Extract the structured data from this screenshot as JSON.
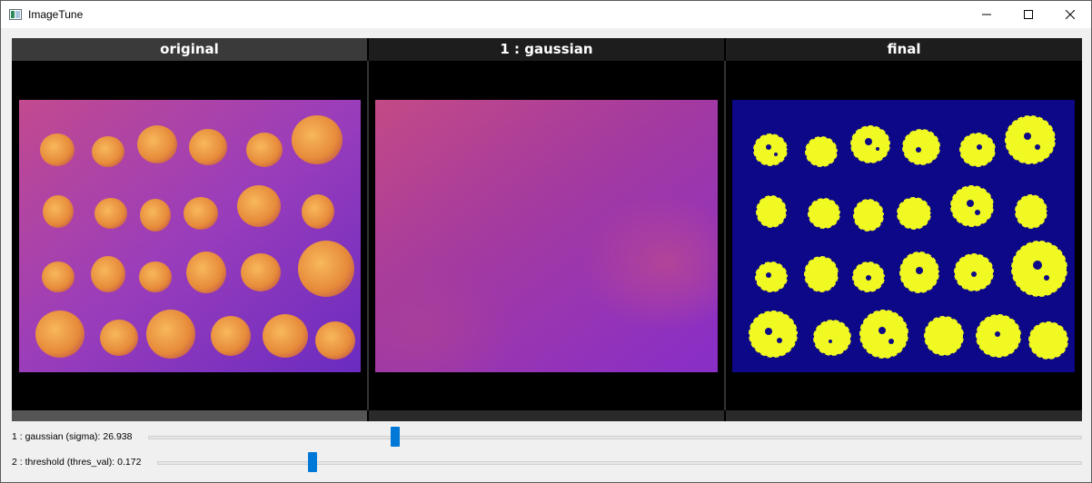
{
  "window": {
    "title": "ImageTune",
    "minimize_glyph": "—",
    "maximize_glyph": "☐",
    "close_glyph": "✕"
  },
  "panels": [
    {
      "title": "original"
    },
    {
      "title": "1 : gaussian"
    },
    {
      "title": "final"
    }
  ],
  "sliders": [
    {
      "label": "1 : gaussian (sigma): 26.938",
      "position_fraction": 0.265
    },
    {
      "label": "2 : threshold (thres_val): 0.172",
      "position_fraction": 0.168
    }
  ],
  "colors": {
    "accent": "#0078d7",
    "coin_fill": "#f0a040",
    "plasma_bg": "#8a2fc6",
    "binary_bg": "#0d0887",
    "binary_fg": "#f0f921"
  }
}
